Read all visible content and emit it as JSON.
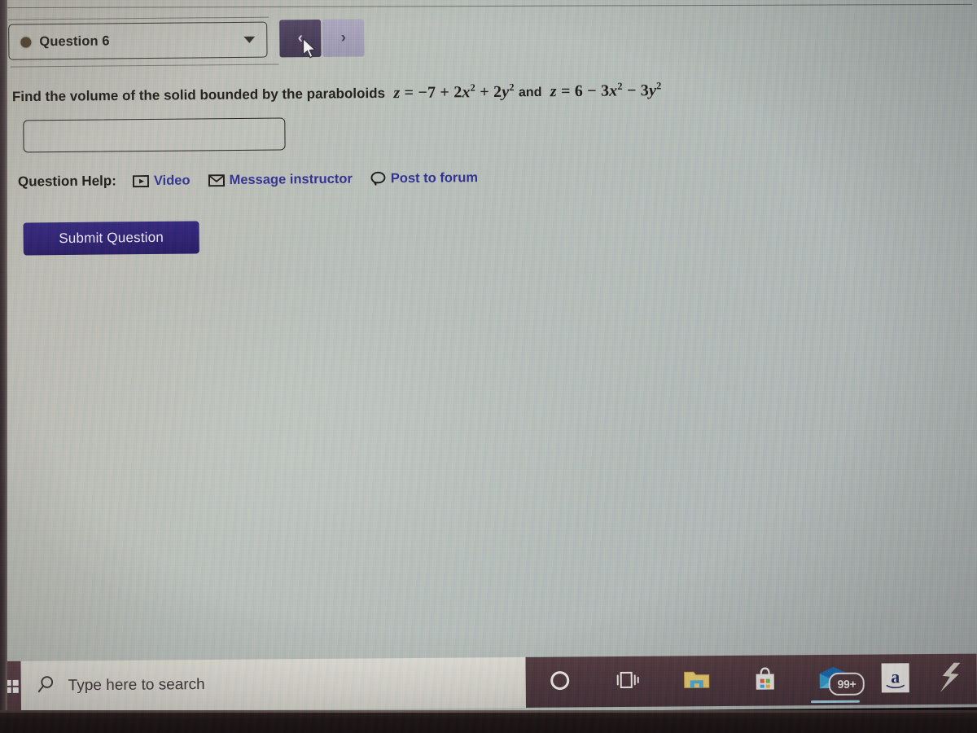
{
  "question_selector": {
    "bullet_icon": "filled-circle-icon",
    "label": "Question 6",
    "caret_icon": "chevron-down-icon"
  },
  "nav": {
    "prev_label": "‹",
    "next_label": "›",
    "prev_icon": "chevron-left-icon",
    "next_icon": "chevron-right-icon"
  },
  "question": {
    "prompt": "Find the volume of the solid bounded by the paraboloids",
    "equation_1": {
      "lhs": "z",
      "equals": "=",
      "minus": "−",
      "t1_coef": "7",
      "plus1": "+",
      "t2_coef": "2",
      "t2_var": "x",
      "t2_exp": "2",
      "plus2": "+",
      "t3_coef": "2",
      "t3_var": "y",
      "t3_exp": "2"
    },
    "conjunction": "and",
    "equation_2": {
      "lhs": "z",
      "equals": "=",
      "t1_coef": "6",
      "minus1": "−",
      "t2_coef": "3",
      "t2_var": "x",
      "t2_exp": "2",
      "minus2": "−",
      "t3_coef": "3",
      "t3_var": "y",
      "t3_exp": "2"
    },
    "plain_text": "Find the volume of the solid bounded by the paraboloids z = -7 + 2x^2 + 2y^2 and z = 6 - 3x^2 - 3y^2"
  },
  "answer_input": {
    "value": "",
    "placeholder": ""
  },
  "help": {
    "label": "Question Help:",
    "links": [
      {
        "label": "Video",
        "icon": "video-play-icon"
      },
      {
        "label": "Message instructor",
        "icon": "envelope-icon"
      },
      {
        "label": "Post to forum",
        "icon": "speech-bubble-icon"
      }
    ],
    "link_color": "#2c2b8f"
  },
  "submit": {
    "label": "Submit Question",
    "color": "#281a6c"
  },
  "taskbar": {
    "start_icon": "windows-start-icon",
    "search": {
      "icon": "search-icon",
      "placeholder": "Type here to search",
      "value": ""
    },
    "icons": [
      {
        "name": "cortana-icon",
        "label": "Cortana"
      },
      {
        "name": "task-view-icon",
        "label": "Task View"
      },
      {
        "name": "file-explorer-icon",
        "label": "File Explorer"
      },
      {
        "name": "microsoft-store-icon",
        "label": "Microsoft Store"
      },
      {
        "name": "mail-icon",
        "label": "Mail",
        "badge": "99+",
        "active": true
      },
      {
        "name": "amazon-icon",
        "label": "a"
      },
      {
        "name": "partial-app-icon",
        "label": ""
      }
    ]
  },
  "colors": {
    "page_background": "#b6b9b3",
    "taskbar_dark": "#49323a",
    "taskbar_light": "#d9d7cf",
    "accent_purple": "#3d3150",
    "link_blue": "#2c2b8f"
  }
}
